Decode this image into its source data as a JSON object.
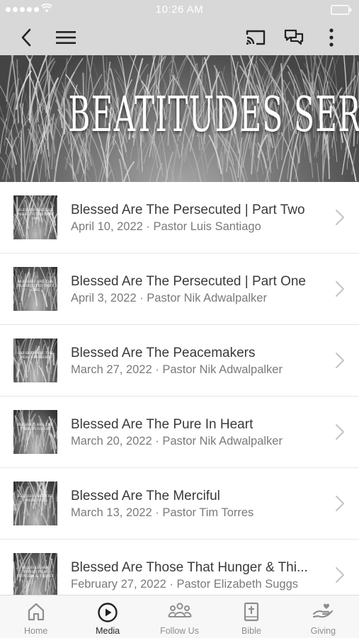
{
  "status_bar": {
    "time": "10:26 AM"
  },
  "nav": {
    "back_icon": "chevron-left-icon",
    "menu_icon": "hamburger-icon",
    "cast_icon": "cast-icon",
    "chat_icon": "chat-bubbles-icon",
    "more_icon": "more-vertical-icon"
  },
  "hero": {
    "title": "Beatitudes Series"
  },
  "sermons": [
    {
      "title": "Blessed Are The Persecuted | Part Two",
      "subtitle": "April 10, 2022 · Pastor Luis Santiago",
      "thumb": "Blessed Are The Persecuted Part Two"
    },
    {
      "title": "Blessed Are The Persecuted | Part One",
      "subtitle": "April 3, 2022 · Pastor Nik Adwalpalker",
      "thumb": "Blessed Are The Persecuted Part One"
    },
    {
      "title": "Blessed Are The Peacemakers",
      "subtitle": "March 27, 2022 · Pastor Nik Adwalpalker",
      "thumb": "Blessed Are The Peacemakers"
    },
    {
      "title": "Blessed Are The Pure In Heart",
      "subtitle": "March 20, 2022 · Pastor Nik Adwalpalker",
      "thumb": "Blessed Are The Pure In Heart"
    },
    {
      "title": "Blessed Are The Merciful",
      "subtitle": "March 13, 2022 · Pastor Tim Torres",
      "thumb": "Blessed Are The Merciful"
    },
    {
      "title": "Blessed Are Those That Hunger & Thi...",
      "subtitle": "February 27, 2022 · Pastor Elizabeth Suggs",
      "thumb": "Blessed Are Those That Hunger & Thirst"
    }
  ],
  "tabs": [
    {
      "label": "Home",
      "icon": "home-icon"
    },
    {
      "label": "Media",
      "icon": "play-circle-icon"
    },
    {
      "label": "Follow Us",
      "icon": "people-icon"
    },
    {
      "label": "Bible",
      "icon": "bible-icon"
    },
    {
      "label": "Giving",
      "icon": "giving-hand-icon"
    }
  ],
  "active_tab": "Media"
}
